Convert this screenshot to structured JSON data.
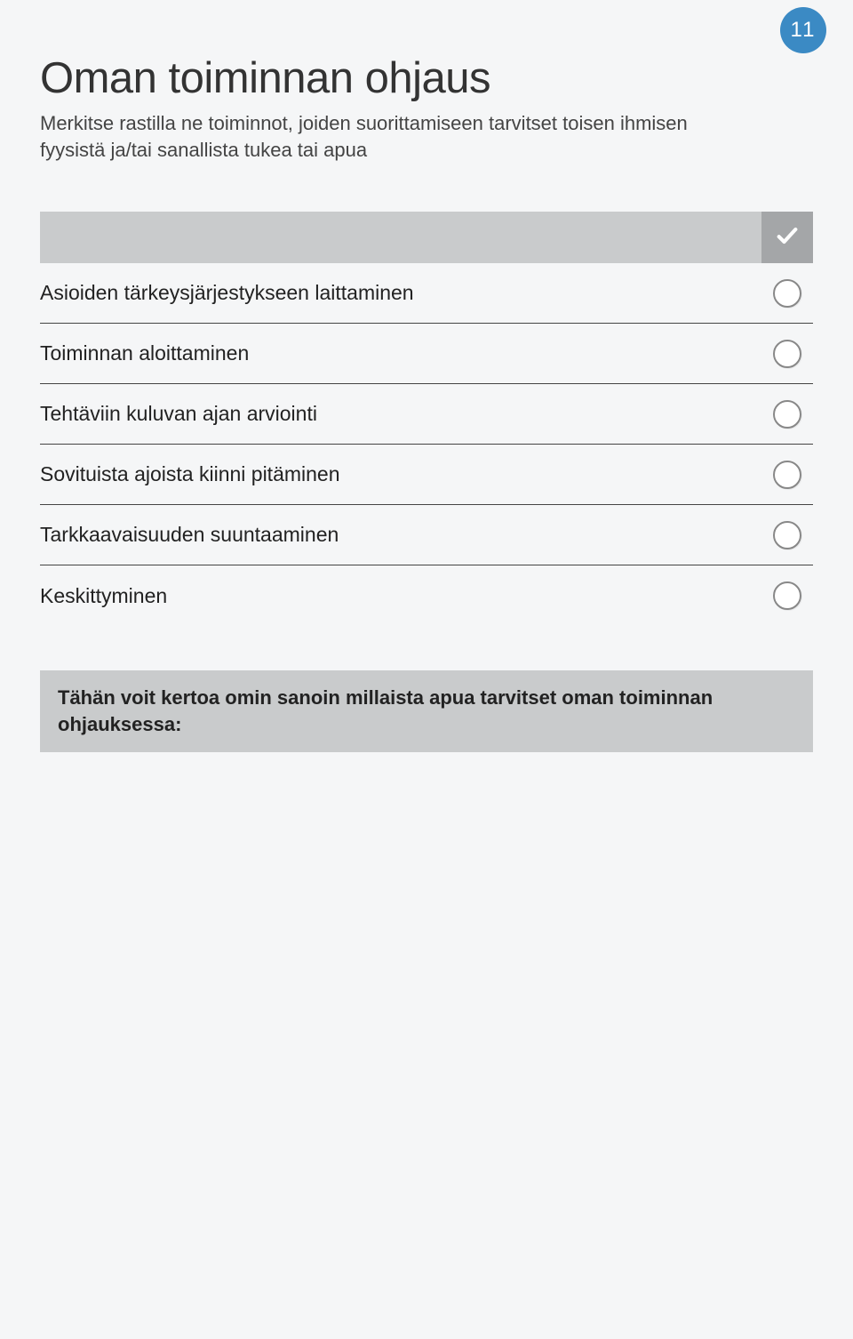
{
  "page_number": "11",
  "title": "Oman toiminnan ohjaus",
  "intro": "Merkitse rastilla ne toiminnot, joiden suorittamiseen tarvitset toisen ihmisen fyysistä ja/tai sanallista tukea tai apua",
  "checklist": {
    "items": [
      {
        "label": "Asioiden tärkeysjärjestykseen laittaminen"
      },
      {
        "label": "Toiminnan aloittaminen"
      },
      {
        "label": "Tehtäviin kuluvan ajan arviointi"
      },
      {
        "label": "Sovituista ajoista kiinni pitäminen"
      },
      {
        "label": "Tarkkaavaisuuden suuntaaminen"
      },
      {
        "label": "Keskittyminen"
      }
    ]
  },
  "notes_header": "Tähän voit kertoa omin sanoin millaista apua tarvitset oman toiminnan ohjauksessa:"
}
